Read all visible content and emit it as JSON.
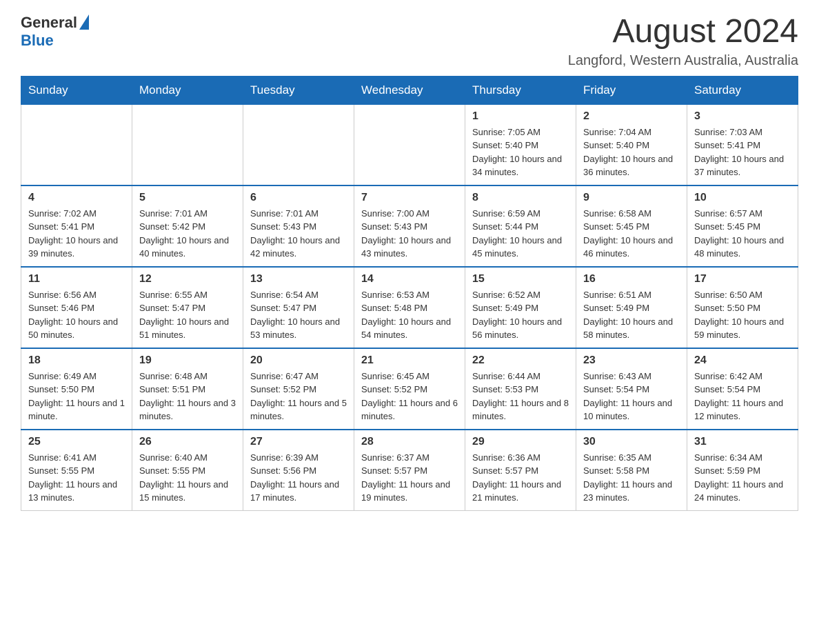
{
  "header": {
    "logo_general": "General",
    "logo_blue": "Blue",
    "month_title": "August 2024",
    "location": "Langford, Western Australia, Australia"
  },
  "calendar": {
    "days_of_week": [
      "Sunday",
      "Monday",
      "Tuesday",
      "Wednesday",
      "Thursday",
      "Friday",
      "Saturday"
    ],
    "weeks": [
      [
        {
          "day": "",
          "info": ""
        },
        {
          "day": "",
          "info": ""
        },
        {
          "day": "",
          "info": ""
        },
        {
          "day": "",
          "info": ""
        },
        {
          "day": "1",
          "info": "Sunrise: 7:05 AM\nSunset: 5:40 PM\nDaylight: 10 hours and 34 minutes."
        },
        {
          "day": "2",
          "info": "Sunrise: 7:04 AM\nSunset: 5:40 PM\nDaylight: 10 hours and 36 minutes."
        },
        {
          "day": "3",
          "info": "Sunrise: 7:03 AM\nSunset: 5:41 PM\nDaylight: 10 hours and 37 minutes."
        }
      ],
      [
        {
          "day": "4",
          "info": "Sunrise: 7:02 AM\nSunset: 5:41 PM\nDaylight: 10 hours and 39 minutes."
        },
        {
          "day": "5",
          "info": "Sunrise: 7:01 AM\nSunset: 5:42 PM\nDaylight: 10 hours and 40 minutes."
        },
        {
          "day": "6",
          "info": "Sunrise: 7:01 AM\nSunset: 5:43 PM\nDaylight: 10 hours and 42 minutes."
        },
        {
          "day": "7",
          "info": "Sunrise: 7:00 AM\nSunset: 5:43 PM\nDaylight: 10 hours and 43 minutes."
        },
        {
          "day": "8",
          "info": "Sunrise: 6:59 AM\nSunset: 5:44 PM\nDaylight: 10 hours and 45 minutes."
        },
        {
          "day": "9",
          "info": "Sunrise: 6:58 AM\nSunset: 5:45 PM\nDaylight: 10 hours and 46 minutes."
        },
        {
          "day": "10",
          "info": "Sunrise: 6:57 AM\nSunset: 5:45 PM\nDaylight: 10 hours and 48 minutes."
        }
      ],
      [
        {
          "day": "11",
          "info": "Sunrise: 6:56 AM\nSunset: 5:46 PM\nDaylight: 10 hours and 50 minutes."
        },
        {
          "day": "12",
          "info": "Sunrise: 6:55 AM\nSunset: 5:47 PM\nDaylight: 10 hours and 51 minutes."
        },
        {
          "day": "13",
          "info": "Sunrise: 6:54 AM\nSunset: 5:47 PM\nDaylight: 10 hours and 53 minutes."
        },
        {
          "day": "14",
          "info": "Sunrise: 6:53 AM\nSunset: 5:48 PM\nDaylight: 10 hours and 54 minutes."
        },
        {
          "day": "15",
          "info": "Sunrise: 6:52 AM\nSunset: 5:49 PM\nDaylight: 10 hours and 56 minutes."
        },
        {
          "day": "16",
          "info": "Sunrise: 6:51 AM\nSunset: 5:49 PM\nDaylight: 10 hours and 58 minutes."
        },
        {
          "day": "17",
          "info": "Sunrise: 6:50 AM\nSunset: 5:50 PM\nDaylight: 10 hours and 59 minutes."
        }
      ],
      [
        {
          "day": "18",
          "info": "Sunrise: 6:49 AM\nSunset: 5:50 PM\nDaylight: 11 hours and 1 minute."
        },
        {
          "day": "19",
          "info": "Sunrise: 6:48 AM\nSunset: 5:51 PM\nDaylight: 11 hours and 3 minutes."
        },
        {
          "day": "20",
          "info": "Sunrise: 6:47 AM\nSunset: 5:52 PM\nDaylight: 11 hours and 5 minutes."
        },
        {
          "day": "21",
          "info": "Sunrise: 6:45 AM\nSunset: 5:52 PM\nDaylight: 11 hours and 6 minutes."
        },
        {
          "day": "22",
          "info": "Sunrise: 6:44 AM\nSunset: 5:53 PM\nDaylight: 11 hours and 8 minutes."
        },
        {
          "day": "23",
          "info": "Sunrise: 6:43 AM\nSunset: 5:54 PM\nDaylight: 11 hours and 10 minutes."
        },
        {
          "day": "24",
          "info": "Sunrise: 6:42 AM\nSunset: 5:54 PM\nDaylight: 11 hours and 12 minutes."
        }
      ],
      [
        {
          "day": "25",
          "info": "Sunrise: 6:41 AM\nSunset: 5:55 PM\nDaylight: 11 hours and 13 minutes."
        },
        {
          "day": "26",
          "info": "Sunrise: 6:40 AM\nSunset: 5:55 PM\nDaylight: 11 hours and 15 minutes."
        },
        {
          "day": "27",
          "info": "Sunrise: 6:39 AM\nSunset: 5:56 PM\nDaylight: 11 hours and 17 minutes."
        },
        {
          "day": "28",
          "info": "Sunrise: 6:37 AM\nSunset: 5:57 PM\nDaylight: 11 hours and 19 minutes."
        },
        {
          "day": "29",
          "info": "Sunrise: 6:36 AM\nSunset: 5:57 PM\nDaylight: 11 hours and 21 minutes."
        },
        {
          "day": "30",
          "info": "Sunrise: 6:35 AM\nSunset: 5:58 PM\nDaylight: 11 hours and 23 minutes."
        },
        {
          "day": "31",
          "info": "Sunrise: 6:34 AM\nSunset: 5:59 PM\nDaylight: 11 hours and 24 minutes."
        }
      ]
    ]
  }
}
